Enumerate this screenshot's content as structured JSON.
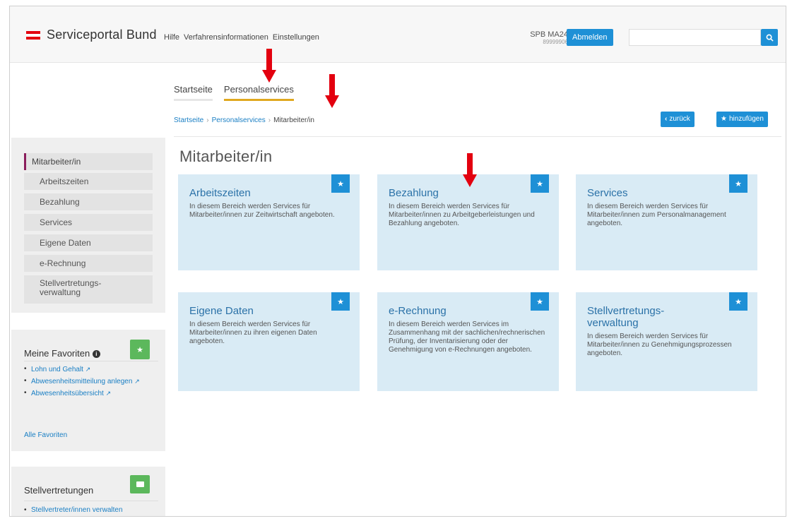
{
  "header": {
    "logo_text": "Serviceportal Bund",
    "nav": [
      "Hilfe",
      "Verfahrensinformationen",
      "Einstellungen"
    ],
    "user_name": "SPB MA24",
    "user_id": "89999906",
    "logout_label": "Abmelden",
    "search_placeholder": ""
  },
  "tabs": [
    {
      "label": "Startseite",
      "active": false
    },
    {
      "label": "Personalservices",
      "active": true
    }
  ],
  "breadcrumb": [
    "Startseite",
    "Personalservices",
    "Mitarbeiter/in"
  ],
  "actions": {
    "back_label": "zurück",
    "add_label": "hinzufügen"
  },
  "sidebar": {
    "items": [
      "Mitarbeiter/in",
      "Arbeitszeiten",
      "Bezahlung",
      "Services",
      "Eigene Daten",
      "e-Rechnung",
      "Stellvertretungs-\nverwaltung"
    ]
  },
  "favorites": {
    "title": "Meine Favoriten",
    "items": [
      "Lohn und Gehalt",
      "Abwesenheitsmitteilung anlegen",
      "Abwesenheitsübersicht"
    ],
    "all_label": "Alle Favoriten"
  },
  "representations": {
    "title": "Stellvertretungen",
    "items": [
      "Stellvertreter/innen verwalten"
    ]
  },
  "main": {
    "title": "Mitarbeiter/in",
    "cards": [
      {
        "title": "Arbeitszeiten",
        "desc": "In diesem Bereich werden Services für Mitarbeiter/innen zur Zeitwirtschaft angeboten."
      },
      {
        "title": "Bezahlung",
        "desc": "In diesem Bereich werden Services für Mitarbeiter/innen zu Arbeitgeberleistungen und Bezahlung angeboten."
      },
      {
        "title": "Services",
        "desc": "In diesem Bereich werden Services für Mitarbeiter/innen zum Personalmanagement angeboten."
      },
      {
        "title": "Eigene Daten",
        "desc": "In diesem Bereich werden Services für Mitarbeiter/innen zu ihren eigenen Daten angeboten."
      },
      {
        "title": "e-Rechnung",
        "desc": "In diesem Bereich werden Services im Zusammenhang mit der sachlichen/rechnerischen Prüfung, der Inventarisierung oder der Genehmigung von e-Rechnungen angeboten."
      },
      {
        "title": "Stellvertretungs-\nverwaltung",
        "desc": "In diesem Bereich werden Services für Mitarbeiter/innen zu Genehmigungsprozessen angeboten."
      }
    ]
  },
  "colors": {
    "accent": "#1e90d6",
    "tab_active": "#e0a81f",
    "card_bg": "#d9ebf5",
    "arrow": "#e3000f",
    "green": "#5cb85c"
  }
}
